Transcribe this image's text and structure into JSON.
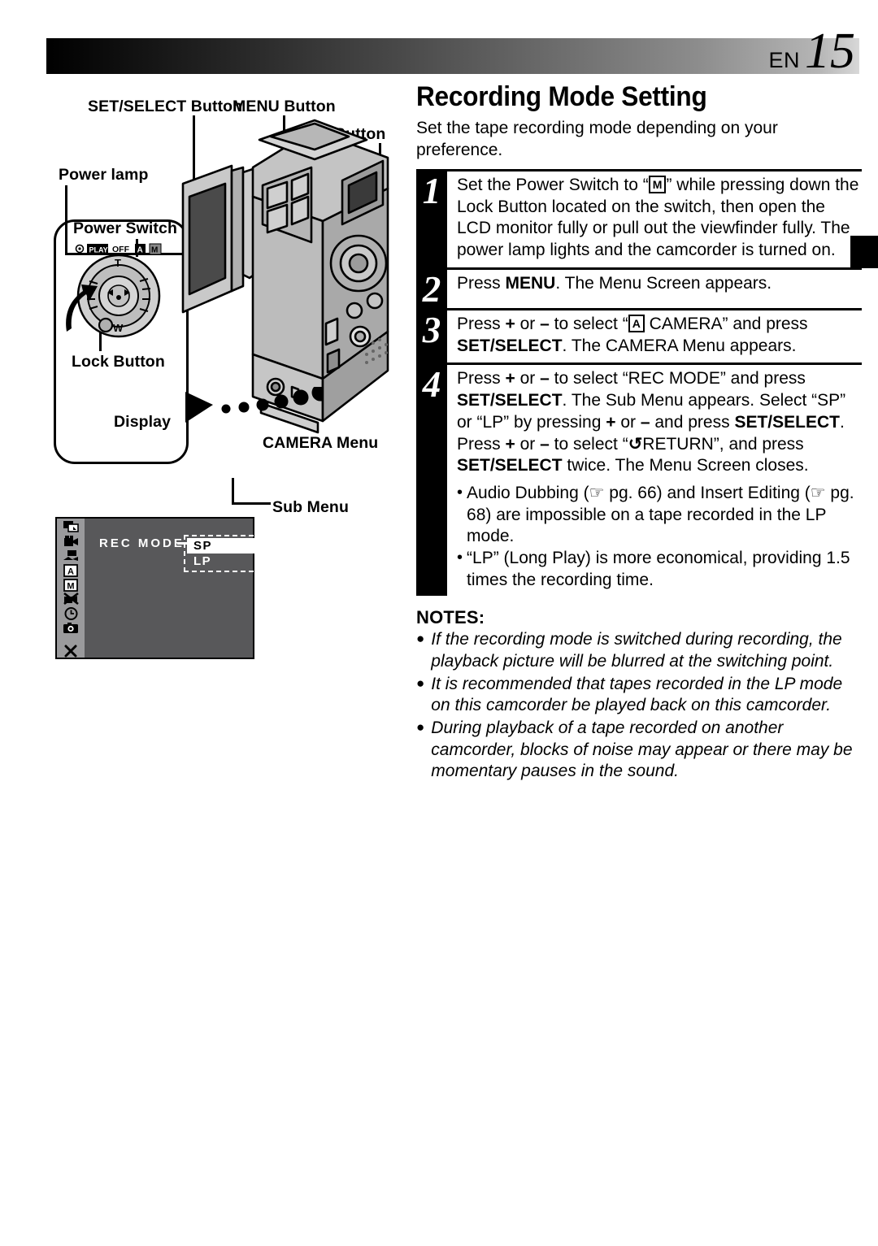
{
  "header": {
    "en_label": "EN",
    "page_number": "15"
  },
  "title": "Recording Mode Setting",
  "intro": "Set the tape recording mode depending on your preference.",
  "diagram": {
    "labels": {
      "set_select_button": "SET/SELECT Button",
      "menu_button": "MENU Button",
      "plus_minus_button": "+, – Button",
      "power_lamp": "Power lamp",
      "power_switch": "Power Switch",
      "lock_button": "Lock Button",
      "display": "Display",
      "camera_menu": "CAMERA Menu",
      "sub_menu": "Sub Menu"
    },
    "power_switch_positions": [
      "PLAY",
      "OFF",
      "A",
      "M"
    ],
    "zoom_marks": {
      "tele": "T",
      "wide": "W"
    }
  },
  "display_screen": {
    "menu_item": "REC MODE",
    "submenu_options": [
      {
        "label": "SP",
        "selected": true
      },
      {
        "label": "LP",
        "selected": false
      }
    ],
    "sidebar_icons": [
      "dubbing-icon",
      "camera-film-icon",
      "playback-monitor-icon",
      "auto-mode-icon",
      "manual-mode-icon",
      "no-video-icon",
      "clock-icon",
      "still-photo-icon",
      "close-menu-icon"
    ],
    "colors": {
      "screen_bg": "#58585a",
      "sidebar_bg": "#9a9a9c",
      "highlight_bg": "#ffffff"
    }
  },
  "steps": [
    {
      "number": "1",
      "parts": [
        {
          "t": "text",
          "v": "Set the Power Switch to “"
        },
        {
          "t": "boxed",
          "v": "M"
        },
        {
          "t": "text",
          "v": "” while pressing down the Lock Button located on the switch, then open the LCD monitor fully or pull out the viewfinder fully. The power lamp lights and the camcorder is turned on."
        }
      ]
    },
    {
      "number": "2",
      "parts": [
        {
          "t": "text",
          "v": "Press "
        },
        {
          "t": "bold",
          "v": "MENU"
        },
        {
          "t": "text",
          "v": ". The Menu Screen appears."
        }
      ]
    },
    {
      "number": "3",
      "parts": [
        {
          "t": "text",
          "v": "Press "
        },
        {
          "t": "bold",
          "v": "+"
        },
        {
          "t": "text",
          "v": " or "
        },
        {
          "t": "bold",
          "v": "–"
        },
        {
          "t": "text",
          "v": " to select “"
        },
        {
          "t": "boxed",
          "v": "A"
        },
        {
          "t": "text",
          "v": " CAMERA” and press "
        },
        {
          "t": "bold",
          "v": "SET/SELECT"
        },
        {
          "t": "text",
          "v": ". The CAMERA Menu appears."
        }
      ]
    },
    {
      "number": "4",
      "parts": [
        {
          "t": "text",
          "v": "Press "
        },
        {
          "t": "bold",
          "v": "+"
        },
        {
          "t": "text",
          "v": " or "
        },
        {
          "t": "bold",
          "v": "–"
        },
        {
          "t": "text",
          "v": " to select “REC MODE” and press "
        },
        {
          "t": "bold",
          "v": "SET/SELECT"
        },
        {
          "t": "text",
          "v": ". The Sub Menu appears. Select “SP” or “LP” by pressing "
        },
        {
          "t": "bold",
          "v": "+"
        },
        {
          "t": "text",
          "v": " or "
        },
        {
          "t": "bold",
          "v": "–"
        },
        {
          "t": "text",
          "v": " and press "
        },
        {
          "t": "bold",
          "v": "SET/SELECT"
        },
        {
          "t": "text",
          "v": ". Press "
        },
        {
          "t": "bold",
          "v": "+"
        },
        {
          "t": "text",
          "v": " or "
        },
        {
          "t": "bold",
          "v": "–"
        },
        {
          "t": "text",
          "v": " to select “"
        },
        {
          "t": "glyph",
          "v": "↺"
        },
        {
          "t": "text",
          "v": "RETURN”, and press "
        },
        {
          "t": "bold",
          "v": "SET/SELECT"
        },
        {
          "t": "text",
          "v": " twice. The Menu Screen closes."
        }
      ],
      "bullets": [
        "Audio Dubbing (☞ pg. 66) and Insert Editing (☞ pg. 68) are impossible on a tape recorded in the LP mode.",
        "“LP” (Long Play) is more economical, providing 1.5 times the recording time."
      ]
    }
  ],
  "notes": {
    "heading": "NOTES:",
    "items": [
      "If the recording mode is switched during recording, the playback picture will be blurred at the switching point.",
      "It is recommended that tapes recorded in the LP mode on this camcorder be played back on this camcorder.",
      "During playback of a tape recorded on another camcorder, blocks of noise may appear or there may be momentary pauses in the sound."
    ]
  }
}
